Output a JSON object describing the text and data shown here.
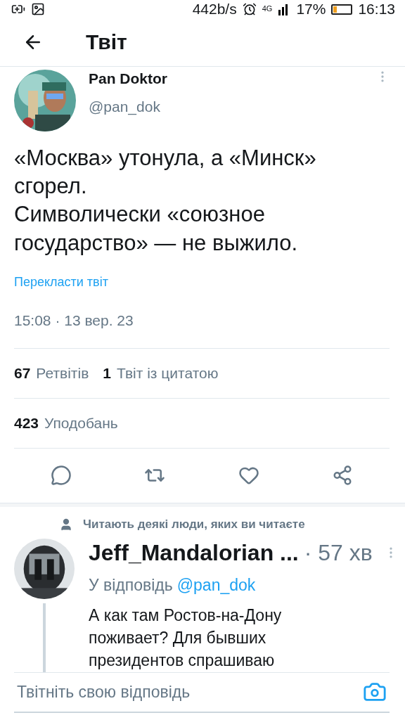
{
  "status_bar": {
    "speed": "442b/s",
    "network": "4G",
    "battery": "17%",
    "time": "16:13"
  },
  "header": {
    "title": "Твіт"
  },
  "tweet": {
    "name": "Pan Doktor",
    "handle": "@pan_dok",
    "text": "«Москва» утонула, а «Минск» сгорел.\nСимволически «союзное государство» — не выжило.",
    "translate": "Перекласти твіт",
    "timestamp": "15:08 · 13 вер. 23",
    "stats": [
      {
        "count": "67",
        "label": "Ретвітів"
      },
      {
        "count": "1",
        "label": "Твіт із цитатою"
      }
    ],
    "likes": {
      "count": "423",
      "label": "Уподобань"
    }
  },
  "social_context": "Читають деякі люди, яких ви читаєте",
  "reply": {
    "name": "Jeff_Mandalorian ...",
    "time": "· 57 хв",
    "replying_prefix": "У відповідь",
    "replying_to": "@pan_dok",
    "text": "А как там Ростов-на-Дону поживает? Для бывших президентов спрашиваю"
  },
  "composer": {
    "placeholder": "Твітніть свою відповідь"
  }
}
